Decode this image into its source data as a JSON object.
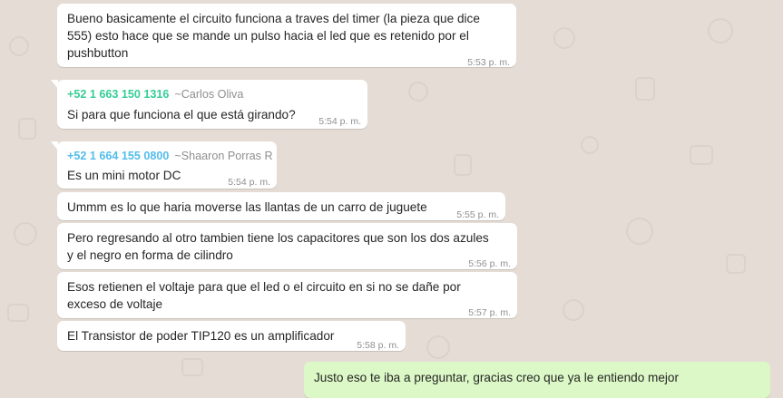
{
  "messages": [
    {
      "lines": [
        "Bueno basicamente el circuito funciona a traves del timer (la pieza que dice",
        "555) esto hace que se mande un pulso hacia el led que es retenido por el",
        "pushbutton"
      ],
      "time": "5:53 p. m."
    },
    {
      "sender_phone": "+52 1 663 150 1316",
      "sender_alias": "~Carlos Oliva",
      "sender_color": "#35cd96",
      "lines": [
        "Si para que funciona el que está girando?"
      ],
      "time": "5:54 p. m."
    },
    {
      "sender_phone": "+52 1 664 155 0800",
      "sender_alias": "~Shaaron Porras R",
      "sender_color": "#53bdeb",
      "lines": [
        "Es un mini motor DC"
      ],
      "time": "5:54 p. m."
    },
    {
      "lines": [
        "Ummm es lo que haria moverse las llantas de un carro de juguete"
      ],
      "time": "5:55 p. m."
    },
    {
      "lines": [
        "Pero regresando al otro tambien tiene los capacitores que son los dos azules",
        "y el negro en forma de cilindro"
      ],
      "time": "5:56 p. m."
    },
    {
      "lines": [
        "Esos retienen el voltaje para que el led o el circuito en si no se dañe por",
        "exceso de voltaje"
      ],
      "time": "5:57 p. m."
    },
    {
      "lines": [
        "El Transistor de poder TIP120 es un amplificador"
      ],
      "time": "5:58 p. m."
    },
    {
      "lines": [
        "Justo eso te iba a preguntar, gracias creo que ya le entiendo mejor"
      ]
    }
  ],
  "colors": {
    "background": "#e5ddd5",
    "incoming": "#ffffff",
    "outgoing": "#dcf8c6"
  }
}
